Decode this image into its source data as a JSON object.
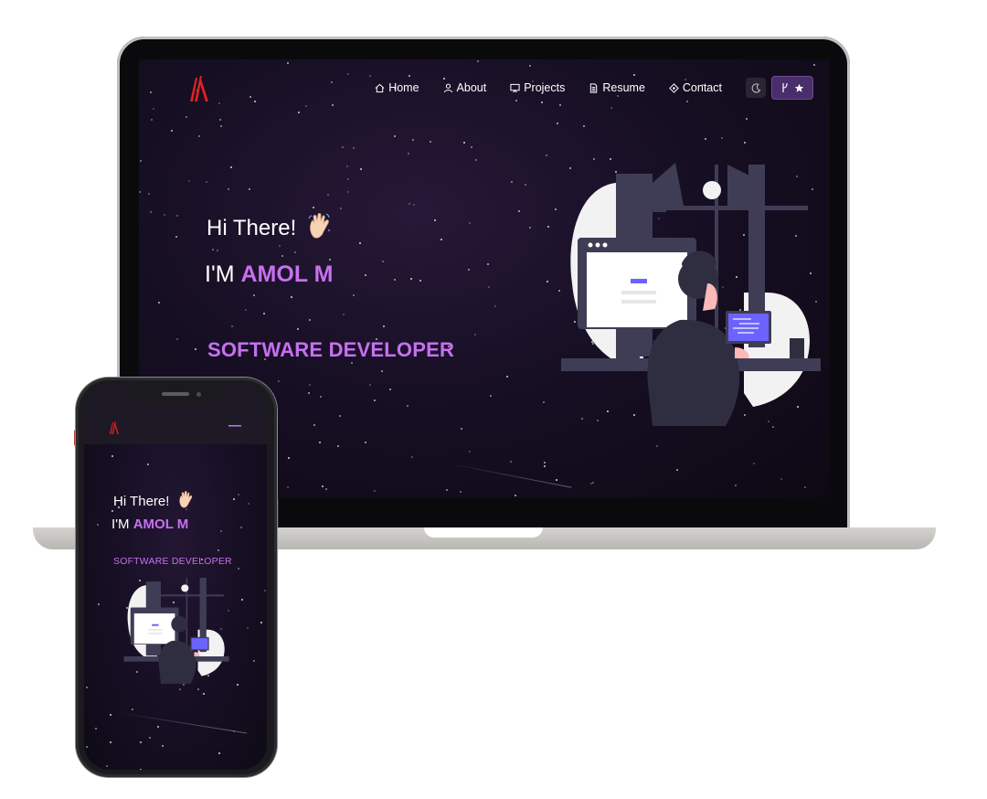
{
  "laptop": {
    "nav": {
      "items": [
        {
          "label": "Home",
          "icon": "home-icon"
        },
        {
          "label": "About",
          "icon": "user-icon"
        },
        {
          "label": "Projects",
          "icon": "projects-icon"
        },
        {
          "label": "Resume",
          "icon": "document-icon"
        },
        {
          "label": "Contact",
          "icon": "contact-icon"
        }
      ],
      "theme_icon": "moon-icon",
      "github_icons": [
        "fork-icon",
        "star-icon"
      ]
    },
    "hero": {
      "greeting": "Hi There!",
      "wave_icon": "waving-hand-icon",
      "name_prefix": "I'M",
      "name": "AMOL M",
      "role": "SOFTWARE DEVELOPER"
    }
  },
  "phone": {
    "hero": {
      "greeting": "Hi There!",
      "name_prefix": "I'M",
      "name": "AMOL M",
      "role": "SOFTWARE DEVELOPER"
    },
    "menu_icon": "hamburger-menu-icon"
  },
  "colors": {
    "accent": "#c770f0",
    "logo": "#e02020",
    "background": "#170f24",
    "github_button": "#4a2e6b"
  }
}
